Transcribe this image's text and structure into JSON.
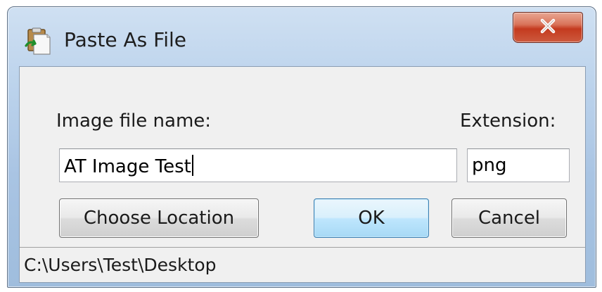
{
  "window": {
    "title": "Paste As File",
    "icon": "paste-clipboard-icon",
    "close_icon": "close-x-icon"
  },
  "form": {
    "filename_label": "Image file name:",
    "filename_value": "AT Image Test",
    "extension_label": "Extension:",
    "extension_value": "png"
  },
  "buttons": {
    "choose_location": "Choose Location",
    "ok": "OK",
    "cancel": "Cancel"
  },
  "status": {
    "path": "C:\\Users\\Test\\Desktop"
  },
  "colors": {
    "close_button": "#c43a1f",
    "default_button": "#bee6fd",
    "window_frame": "#a9c4e3"
  }
}
